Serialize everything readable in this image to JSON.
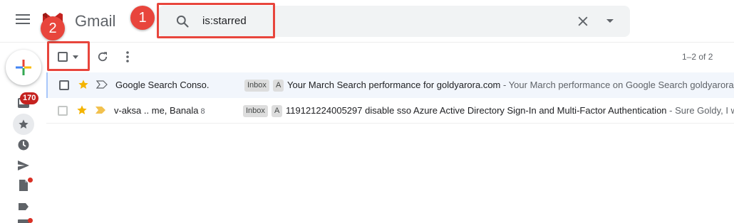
{
  "header": {
    "app_name": "Gmail",
    "search": {
      "value": "is:starred"
    }
  },
  "annotations": {
    "step1": "1",
    "step2": "2"
  },
  "nav": {
    "unread_count": "170"
  },
  "toolbar": {
    "page_info": "1–2 of 2"
  },
  "emails": [
    {
      "sender": "Google Search Conso.",
      "thread_count": "",
      "labels": [
        "Inbox",
        "A"
      ],
      "subject": "Your March Search performance for goldyarora.com",
      "snippet": " - Your March performance on Google Search goldyarora.",
      "starred": true,
      "important": false
    },
    {
      "sender": "v-aksa .. me, Banala",
      "thread_count": "8",
      "labels": [
        "Inbox",
        "A"
      ],
      "subject": "119121224005297 disable sso Azure Active Directory Sign-In and Multi-Factor Authentication",
      "snippet": " - Sure Goldy, I w",
      "starred": true,
      "important": true
    }
  ],
  "colors": {
    "accent_red": "#e8453c",
    "star_yellow": "#f4b400",
    "importance_yellow": "#f2c14e",
    "selected_row": "#f2f6fc"
  },
  "icons": [
    "menu-icon",
    "gmail-logo",
    "search-icon",
    "close-icon",
    "chevron-down-icon",
    "plus-icon",
    "inbox-icon",
    "star-icon",
    "clock-icon",
    "send-icon",
    "draft-icon",
    "label-icon",
    "refresh-icon",
    "more-vert-icon",
    "importance-icon"
  ]
}
